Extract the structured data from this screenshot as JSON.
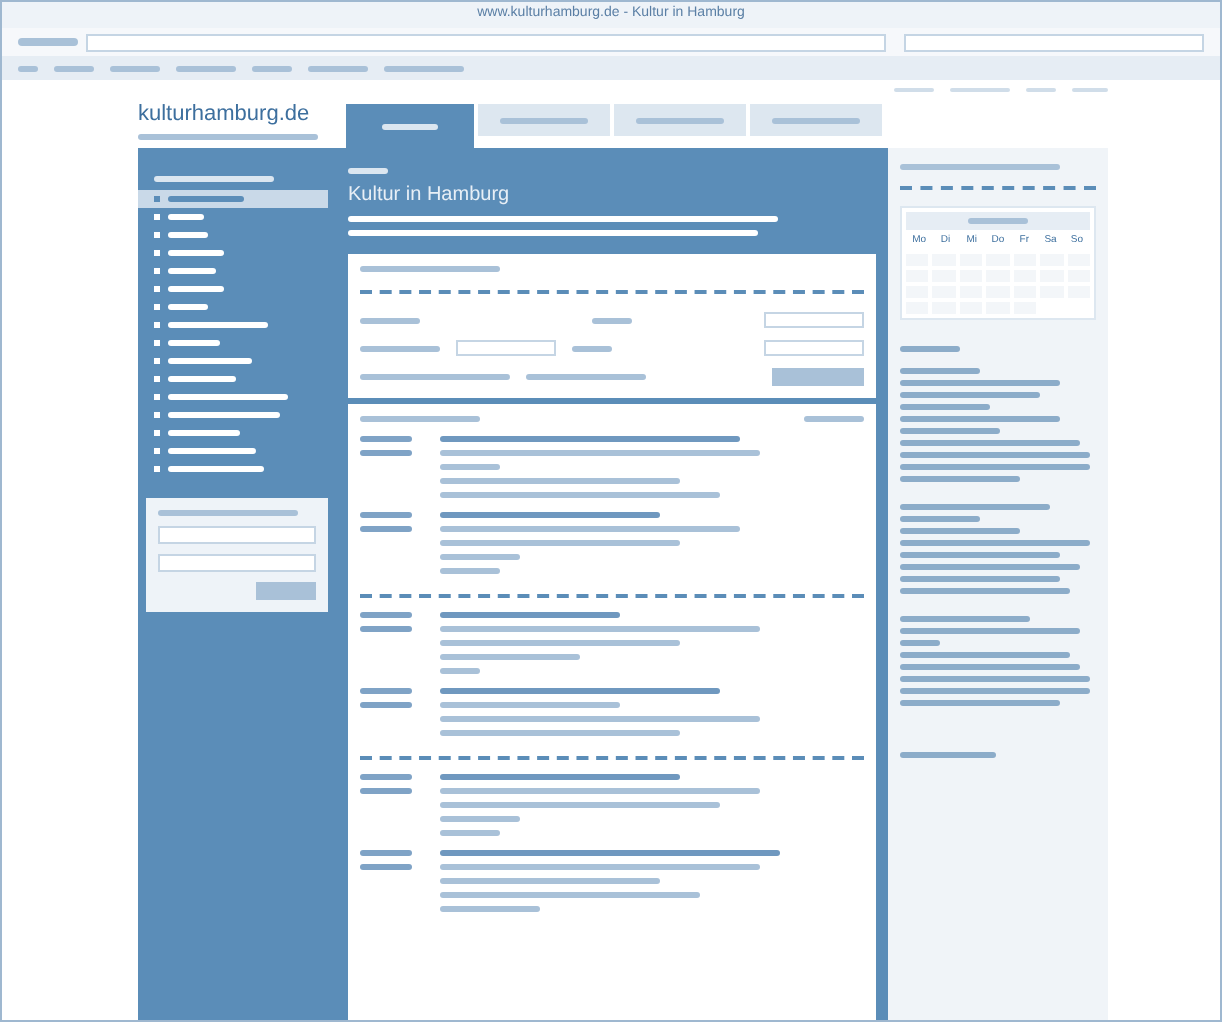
{
  "window": {
    "title": "www.kulturhamburg.de - Kultur in Hamburg"
  },
  "site": {
    "logo": "kulturhamburg.de",
    "heading": "Kultur in Hamburg"
  },
  "tabs": [
    {
      "selected": true
    },
    {
      "selected": false
    },
    {
      "selected": false
    },
    {
      "selected": false
    }
  ],
  "sidebar": {
    "items": [
      {
        "selected": true
      },
      {
        "selected": false
      },
      {
        "selected": false
      },
      {
        "selected": false
      },
      {
        "selected": false
      },
      {
        "selected": false
      },
      {
        "selected": false
      },
      {
        "selected": false
      },
      {
        "selected": false
      },
      {
        "selected": false
      },
      {
        "selected": false
      },
      {
        "selected": false
      },
      {
        "selected": false
      },
      {
        "selected": false
      },
      {
        "selected": false
      },
      {
        "selected": false
      }
    ]
  },
  "calendar": {
    "weekdays": [
      "Mo",
      "Di",
      "Mi",
      "Do",
      "Fr",
      "Sa",
      "So"
    ]
  }
}
